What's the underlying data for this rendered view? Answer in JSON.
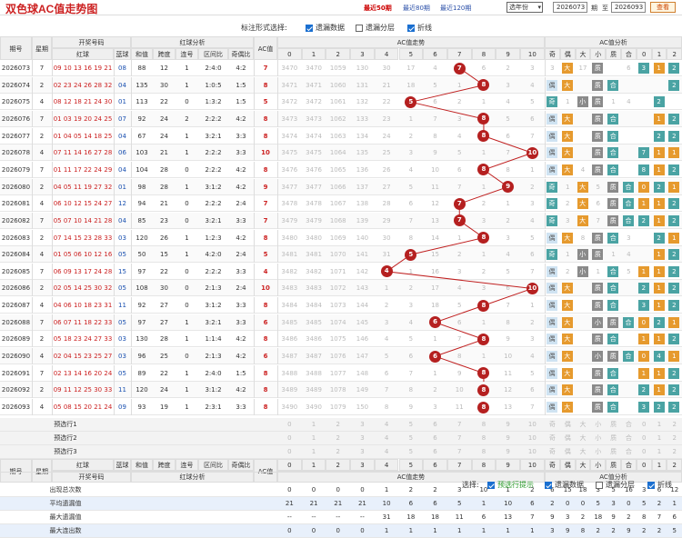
{
  "title": "双色球AC值走势图",
  "top_links": [
    {
      "label": "最近50期",
      "active": true
    },
    {
      "label": "最近80期",
      "active": false
    },
    {
      "label": "最近120期",
      "active": false
    }
  ],
  "year_select": "选年份",
  "range": {
    "from": "2026073",
    "period1": "期",
    "to_label": "至",
    "to": "2026093",
    "period2": "期"
  },
  "query_button": "查看",
  "options": {
    "label": "标注形式选择:",
    "items": [
      {
        "label": "遗漏数据",
        "checked": true
      },
      {
        "label": "遗漏分层",
        "checked": false
      },
      {
        "label": "折线",
        "checked": true
      }
    ]
  },
  "headers": {
    "issue": "期号",
    "week": "星期",
    "open": "开奖号码",
    "red": "红球",
    "blue": "蓝球",
    "redanalysis": "红球分析",
    "sum": "和值",
    "span": "跨度",
    "consec": "连号",
    "zone": "区间比",
    "oddeven": "奇偶比",
    "ac": "AC值",
    "actrend": "AC值走势",
    "acanalysis": "AC值分析",
    "ac_cols": [
      "0",
      "1",
      "2",
      "3",
      "4",
      "5",
      "6",
      "7",
      "8",
      "9",
      "10"
    ],
    "an_cols": [
      "奇",
      "偶",
      "大",
      "小",
      "质",
      "合",
      "0",
      "1",
      "2"
    ]
  },
  "rows": [
    {
      "issue": "2026073",
      "week": "7",
      "red": "09 10 13 16 19 21",
      "blue": "08",
      "sum": "88",
      "span": "12",
      "consec": "1",
      "zone": "2:4:0",
      "oe": "4:2",
      "ac": 7,
      "miss": [
        "3470",
        "3470",
        "1059",
        "130",
        "30",
        "17",
        "4",
        "",
        "6",
        "2",
        "3"
      ],
      "an": [
        "3",
        "大",
        "17",
        "质",
        "",
        "6",
        "3",
        "1",
        "2"
      ]
    },
    {
      "issue": "2026074",
      "week": "2",
      "red": "02 23 24 26 28 32",
      "blue": "04",
      "sum": "135",
      "span": "30",
      "consec": "1",
      "zone": "1:0:5",
      "oe": "1:5",
      "ac": 8,
      "miss": [
        "3471",
        "3471",
        "1060",
        "131",
        "21",
        "18",
        "5",
        "1",
        "",
        "3",
        "4"
      ],
      "an": [
        "偶",
        "大",
        "",
        "质",
        "合",
        "",
        "",
        "",
        "2"
      ]
    },
    {
      "issue": "2026075",
      "week": "4",
      "red": "08 12 18 21 24 30",
      "blue": "01",
      "sum": "113",
      "span": "22",
      "consec": "0",
      "zone": "1:3:2",
      "oe": "1:5",
      "ac": 5,
      "miss": [
        "3472",
        "3472",
        "1061",
        "132",
        "22",
        "",
        "6",
        "2",
        "1",
        "4",
        "5"
      ],
      "an": [
        "奇",
        "1",
        "小",
        "质",
        "1",
        "4",
        "",
        "2",
        ""
      ]
    },
    {
      "issue": "2026076",
      "week": "7",
      "red": "01 03 19 20 24 25",
      "blue": "07",
      "sum": "92",
      "span": "24",
      "consec": "2",
      "zone": "2:2:2",
      "oe": "4:2",
      "ac": 8,
      "miss": [
        "3473",
        "3473",
        "1062",
        "133",
        "23",
        "1",
        "7",
        "3",
        "",
        "5",
        "6"
      ],
      "an": [
        "偶",
        "大",
        "",
        "质",
        "合",
        "",
        "",
        "1",
        "2"
      ]
    },
    {
      "issue": "2026077",
      "week": "2",
      "red": "01 04 05 14 18 25",
      "blue": "04",
      "sum": "67",
      "span": "24",
      "consec": "1",
      "zone": "3:2:1",
      "oe": "3:3",
      "ac": 8,
      "miss": [
        "3474",
        "3474",
        "1063",
        "134",
        "24",
        "2",
        "8",
        "4",
        "",
        "6",
        "7"
      ],
      "an": [
        "偶",
        "大",
        "",
        "质",
        "合",
        "",
        "",
        "2",
        "2"
      ]
    },
    {
      "issue": "2026078",
      "week": "4",
      "red": "07 11 14 16 27 28",
      "blue": "06",
      "sum": "103",
      "span": "21",
      "consec": "1",
      "zone": "2:2:2",
      "oe": "3:3",
      "ac": 10,
      "miss": [
        "3475",
        "3475",
        "1064",
        "135",
        "25",
        "3",
        "9",
        "5",
        "1",
        "7",
        ""
      ],
      "an": [
        "偶",
        "大",
        "",
        "质",
        "合",
        "",
        "7",
        "1",
        "1"
      ]
    },
    {
      "issue": "2026079",
      "week": "7",
      "red": "01 11 17 22 24 29",
      "blue": "04",
      "sum": "104",
      "span": "28",
      "consec": "0",
      "zone": "2:2:2",
      "oe": "4:2",
      "ac": 8,
      "miss": [
        "3476",
        "3476",
        "1065",
        "136",
        "26",
        "4",
        "10",
        "6",
        "",
        "8",
        "1"
      ],
      "an": [
        "偶",
        "大",
        "4",
        "质",
        "合",
        "",
        "8",
        "1",
        "2"
      ]
    },
    {
      "issue": "2026080",
      "week": "2",
      "red": "04 05 11 19 27 32",
      "blue": "01",
      "sum": "98",
      "span": "28",
      "consec": "1",
      "zone": "3:1:2",
      "oe": "4:2",
      "ac": 9,
      "miss": [
        "3477",
        "3477",
        "1066",
        "137",
        "27",
        "5",
        "11",
        "7",
        "1",
        "",
        "2"
      ],
      "an": [
        "奇",
        "1",
        "大",
        "5",
        "质",
        "合",
        "0",
        "2",
        "1"
      ]
    },
    {
      "issue": "2026081",
      "week": "4",
      "red": "06 10 12 15 24 27",
      "blue": "12",
      "sum": "94",
      "span": "21",
      "consec": "0",
      "zone": "2:2:2",
      "oe": "2:4",
      "ac": 7,
      "miss": [
        "3478",
        "3478",
        "1067",
        "138",
        "28",
        "6",
        "12",
        "",
        "2",
        "1",
        "3"
      ],
      "an": [
        "奇",
        "2",
        "大",
        "6",
        "质",
        "合",
        "1",
        "1",
        "2"
      ]
    },
    {
      "issue": "2026082",
      "week": "7",
      "red": "05 07 10 14 21 28",
      "blue": "04",
      "sum": "85",
      "span": "23",
      "consec": "0",
      "zone": "3:2:1",
      "oe": "3:3",
      "ac": 7,
      "miss": [
        "3479",
        "3479",
        "1068",
        "139",
        "29",
        "7",
        "13",
        "",
        "3",
        "2",
        "4"
      ],
      "an": [
        "奇",
        "3",
        "大",
        "7",
        "质",
        "合",
        "2",
        "1",
        "2"
      ]
    },
    {
      "issue": "2026083",
      "week": "2",
      "red": "07 14 15 23 28 33",
      "blue": "03",
      "sum": "120",
      "span": "26",
      "consec": "1",
      "zone": "1:2:3",
      "oe": "4:2",
      "ac": 8,
      "miss": [
        "3480",
        "3480",
        "1069",
        "140",
        "30",
        "8",
        "14",
        "1",
        "",
        "3",
        "5"
      ],
      "an": [
        "偶",
        "大",
        "8",
        "质",
        "合",
        "3",
        "",
        "2",
        "1"
      ]
    },
    {
      "issue": "2026084",
      "week": "4",
      "red": "01 05 06 10 12 16",
      "blue": "05",
      "sum": "50",
      "span": "15",
      "consec": "1",
      "zone": "4:2:0",
      "oe": "2:4",
      "ac": 5,
      "miss": [
        "3481",
        "3481",
        "1070",
        "141",
        "31",
        "",
        "15",
        "2",
        "1",
        "4",
        "6"
      ],
      "an": [
        "奇",
        "1",
        "小",
        "质",
        "1",
        "4",
        "",
        "1",
        "2"
      ]
    },
    {
      "issue": "2026085",
      "week": "7",
      "red": "06 09 13 17 24 28",
      "blue": "15",
      "sum": "97",
      "span": "22",
      "consec": "0",
      "zone": "2:2:2",
      "oe": "3:3",
      "ac": 4,
      "miss": [
        "3482",
        "3482",
        "1071",
        "142",
        "",
        "1",
        "16",
        "3",
        "2",
        "5",
        "7"
      ],
      "an": [
        "偶",
        "2",
        "小",
        "1",
        "合",
        "5",
        "1",
        "1",
        "2"
      ]
    },
    {
      "issue": "2026086",
      "week": "2",
      "red": "02 05 14 25 30 32",
      "blue": "05",
      "sum": "108",
      "span": "30",
      "consec": "0",
      "zone": "2:1:3",
      "oe": "2:4",
      "ac": 10,
      "miss": [
        "3483",
        "3483",
        "1072",
        "143",
        "1",
        "2",
        "17",
        "4",
        "3",
        "6",
        ""
      ],
      "an": [
        "偶",
        "大",
        "",
        "质",
        "合",
        "",
        "2",
        "1",
        "2"
      ]
    },
    {
      "issue": "2026087",
      "week": "4",
      "red": "04 06 10 18 23 31",
      "blue": "11",
      "sum": "92",
      "span": "27",
      "consec": "0",
      "zone": "3:1:2",
      "oe": "3:3",
      "ac": 8,
      "miss": [
        "3484",
        "3484",
        "1073",
        "144",
        "2",
        "3",
        "18",
        "5",
        "",
        "7",
        "1"
      ],
      "an": [
        "偶",
        "大",
        "",
        "质",
        "合",
        "",
        "3",
        "1",
        "2"
      ]
    },
    {
      "issue": "2026088",
      "week": "7",
      "red": "06 07 11 18 22 33",
      "blue": "05",
      "sum": "97",
      "span": "27",
      "consec": "1",
      "zone": "3:2:1",
      "oe": "3:3",
      "ac": 6,
      "miss": [
        "3485",
        "3485",
        "1074",
        "145",
        "3",
        "4",
        "",
        "6",
        "1",
        "8",
        "2"
      ],
      "an": [
        "偶",
        "大",
        "",
        "小",
        "质",
        "合",
        "0",
        "2",
        "1"
      ]
    },
    {
      "issue": "2026089",
      "week": "2",
      "red": "05 18 23 24 27 33",
      "blue": "03",
      "sum": "130",
      "span": "28",
      "consec": "1",
      "zone": "1:1:4",
      "oe": "4:2",
      "ac": 8,
      "miss": [
        "3486",
        "3486",
        "1075",
        "146",
        "4",
        "5",
        "1",
        "7",
        "",
        "9",
        "3"
      ],
      "an": [
        "偶",
        "大",
        "",
        "质",
        "合",
        "",
        "1",
        "1",
        "2"
      ]
    },
    {
      "issue": "2026090",
      "week": "4",
      "red": "02 04 15 23 25 27",
      "blue": "03",
      "sum": "96",
      "span": "25",
      "consec": "0",
      "zone": "2:1:3",
      "oe": "4:2",
      "ac": 6,
      "miss": [
        "3487",
        "3487",
        "1076",
        "147",
        "5",
        "6",
        "",
        "8",
        "1",
        "10",
        "4"
      ],
      "an": [
        "偶",
        "大",
        "",
        "小",
        "质",
        "合",
        "0",
        "4",
        "1"
      ]
    },
    {
      "issue": "2026091",
      "week": "7",
      "red": "02 13 14 16 20 24",
      "blue": "05",
      "sum": "89",
      "span": "22",
      "consec": "1",
      "zone": "2:4:0",
      "oe": "1:5",
      "ac": 8,
      "miss": [
        "3488",
        "3488",
        "1077",
        "148",
        "6",
        "7",
        "1",
        "9",
        "",
        "11",
        "5"
      ],
      "an": [
        "偶",
        "大",
        "",
        "质",
        "合",
        "",
        "1",
        "1",
        "2"
      ]
    },
    {
      "issue": "2026092",
      "week": "2",
      "red": "09 11 12 25 30 33",
      "blue": "11",
      "sum": "120",
      "span": "24",
      "consec": "1",
      "zone": "3:1:2",
      "oe": "4:2",
      "ac": 8,
      "miss": [
        "3489",
        "3489",
        "1078",
        "149",
        "7",
        "8",
        "2",
        "10",
        "",
        "12",
        "6"
      ],
      "an": [
        "偶",
        "大",
        "",
        "质",
        "合",
        "",
        "2",
        "1",
        "2"
      ]
    },
    {
      "issue": "2026093",
      "week": "4",
      "red": "05 08 15 20 21 24",
      "blue": "09",
      "sum": "93",
      "span": "19",
      "consec": "1",
      "zone": "2:3:1",
      "oe": "3:3",
      "ac": 8,
      "miss": [
        "3490",
        "3490",
        "1079",
        "150",
        "8",
        "9",
        "3",
        "11",
        "",
        "13",
        "7"
      ],
      "an": [
        "偶",
        "大",
        "",
        "质",
        "合",
        "",
        "3",
        "2",
        "2"
      ]
    }
  ],
  "preselect": [
    "预选行1",
    "预选行2",
    "预选行3"
  ],
  "pre_ac": [
    "0",
    "1",
    "2",
    "3",
    "4",
    "5",
    "6",
    "7",
    "8",
    "9",
    "10"
  ],
  "pre_an": [
    "奇",
    "偶",
    "大",
    "小",
    "质",
    "合",
    "0",
    "1",
    "2"
  ],
  "stats": [
    {
      "label": "出现总次数",
      "ac": [
        "0",
        "0",
        "0",
        "0",
        "1",
        "2",
        "2",
        "3",
        "10",
        "1",
        "2"
      ],
      "an": [
        "6",
        "15",
        "18",
        "3",
        "5",
        "16",
        "3",
        "6",
        "12"
      ]
    },
    {
      "label": "平均遗漏值",
      "ac": [
        "21",
        "21",
        "21",
        "21",
        "10",
        "6",
        "6",
        "5",
        "1",
        "10",
        "6"
      ],
      "an": [
        "2",
        "0",
        "0",
        "5",
        "3",
        "0",
        "5",
        "2",
        "1"
      ]
    },
    {
      "label": "最大遗漏值",
      "ac": [
        "--",
        "--",
        "--",
        "--",
        "31",
        "18",
        "18",
        "11",
        "6",
        "13",
        "7"
      ],
      "an": [
        "9",
        "3",
        "2",
        "18",
        "9",
        "2",
        "8",
        "7",
        "6"
      ]
    },
    {
      "label": "最大连出数",
      "ac": [
        "0",
        "0",
        "0",
        "0",
        "1",
        "1",
        "1",
        "1",
        "1",
        "1",
        "1"
      ],
      "an": [
        "3",
        "9",
        "8",
        "2",
        "2",
        "9",
        "2",
        "2",
        "5"
      ]
    }
  ],
  "bottom": {
    "label": "选择:",
    "items": [
      {
        "label": "预选行提示",
        "checked": true,
        "green": true
      },
      {
        "label": "遗漏数据",
        "checked": true
      },
      {
        "label": "遗漏分层",
        "checked": false
      },
      {
        "label": "折线",
        "checked": true
      }
    ]
  }
}
